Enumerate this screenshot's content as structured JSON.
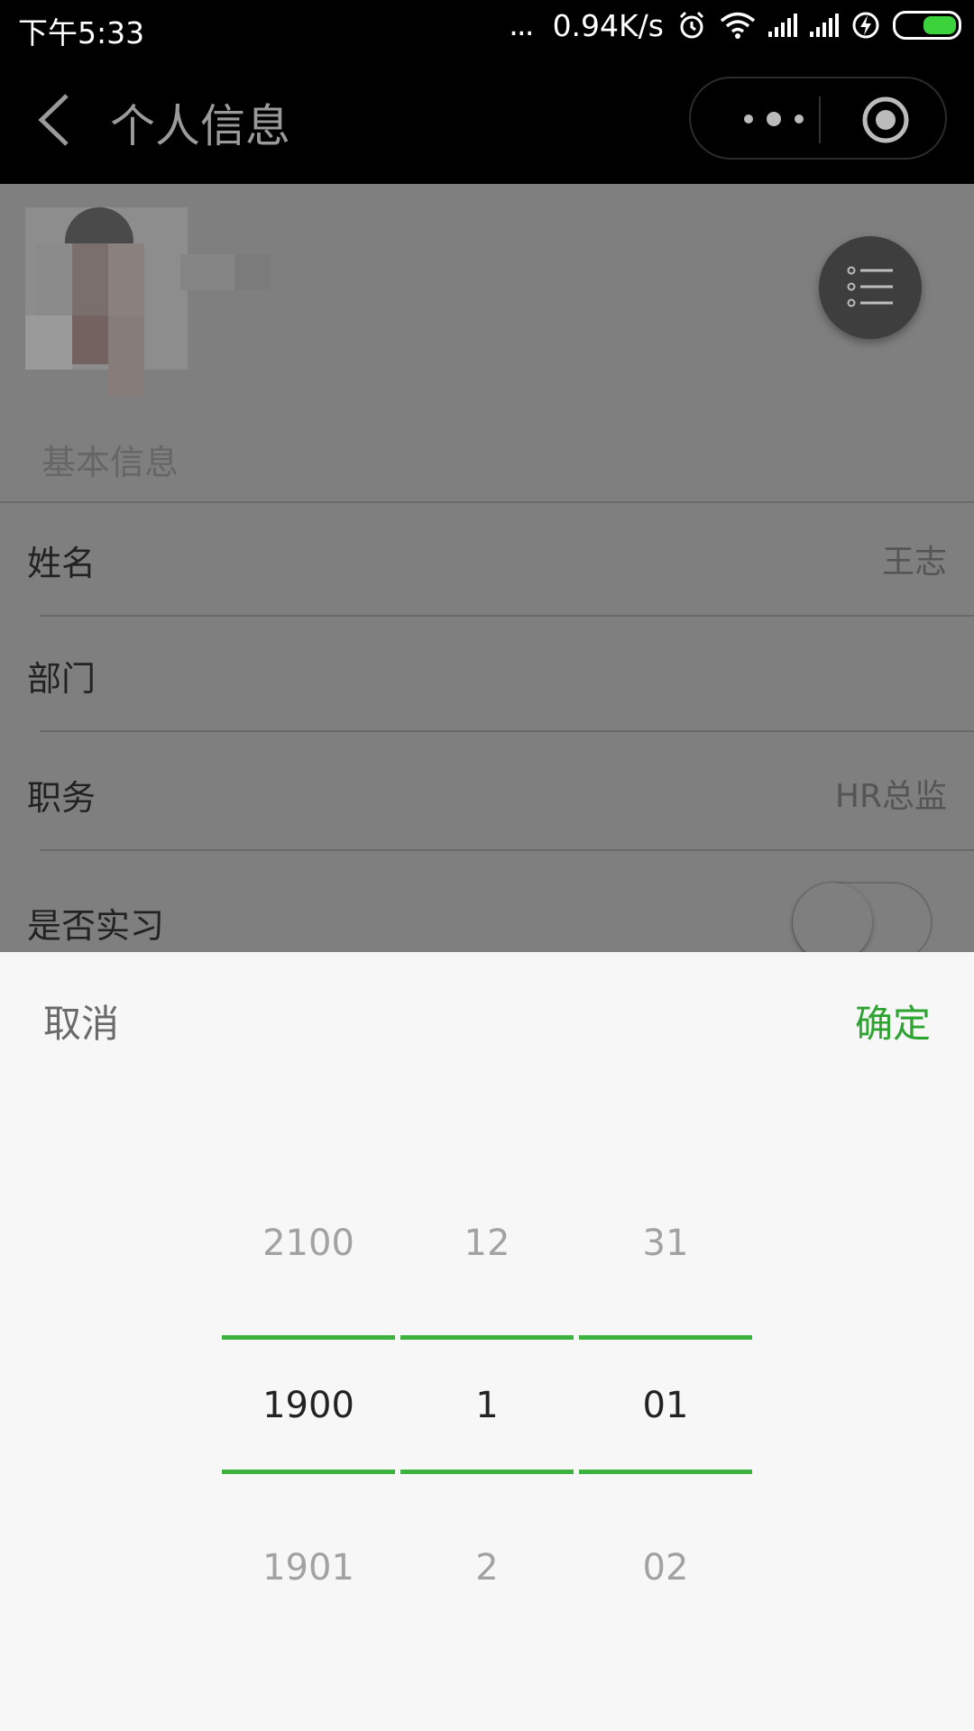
{
  "status_bar": {
    "time": "下午5:33",
    "more_dots": "...",
    "net_speed": "0.94K/s",
    "icons": [
      "alarm-icon",
      "wifi-icon",
      "signal-icon",
      "signal-icon",
      "charging-icon",
      "battery-icon"
    ],
    "battery_color": "#3bd23b"
  },
  "navbar": {
    "title": "个人信息",
    "back_icon": "chevron-left-icon",
    "more_icon": "more-dots-icon",
    "close_icon": "target-circle-icon"
  },
  "profile": {
    "avatar_icon": "avatar-pixelated",
    "fab_icon": "list-menu-icon"
  },
  "section": {
    "title": "基本信息"
  },
  "fields": [
    {
      "label": "姓名",
      "value": "王志"
    },
    {
      "label": "部门",
      "value": ""
    },
    {
      "label": "职务",
      "value": "HR总监"
    },
    {
      "label": "是否实习",
      "toggle_on": false
    }
  ],
  "picker": {
    "cancel": "取消",
    "confirm": "确定",
    "accent": "#2ea430",
    "columns": [
      {
        "prev": "2100",
        "selected": "1900",
        "next": "1901"
      },
      {
        "prev": "12",
        "selected": "1",
        "next": "2"
      },
      {
        "prev": "31",
        "selected": "01",
        "next": "02"
      }
    ]
  }
}
